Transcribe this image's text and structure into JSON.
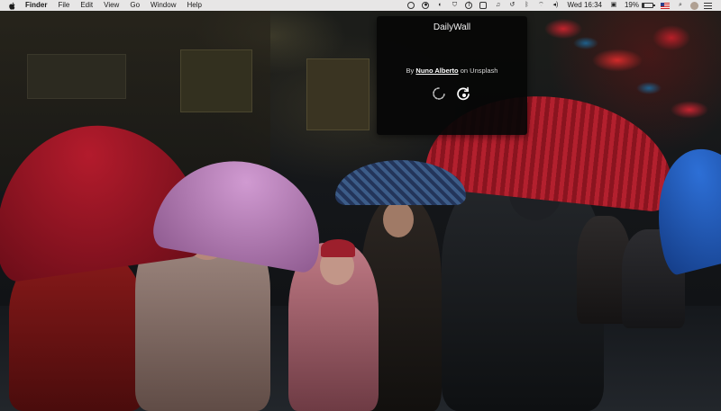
{
  "menubar": {
    "app_name": "Finder",
    "menus": [
      "File",
      "Edit",
      "View",
      "Go",
      "Window",
      "Help"
    ],
    "status_icons": [
      "dailywall-icon",
      "record-icon",
      "focus-icon",
      "shield-icon",
      "info-icon",
      "square-icon",
      "headphones-icon",
      "timemachine-icon",
      "bluetooth-icon",
      "wifi-icon",
      "volume-icon"
    ],
    "clock": "Wed 16:34",
    "battery_percent": "19%",
    "battery_level": 0.19
  },
  "popover": {
    "title": "DailyWall",
    "credit_prefix": "By",
    "author": "Nuno Alberto",
    "credit_middle": "on",
    "source": "Unsplash",
    "buttons": [
      "refresh-icon",
      "reload-settings-icon"
    ]
  },
  "colors": {
    "menubar_bg": "#e7e6e6",
    "popover_bg": "#060606",
    "text_light": "#ffffff"
  }
}
